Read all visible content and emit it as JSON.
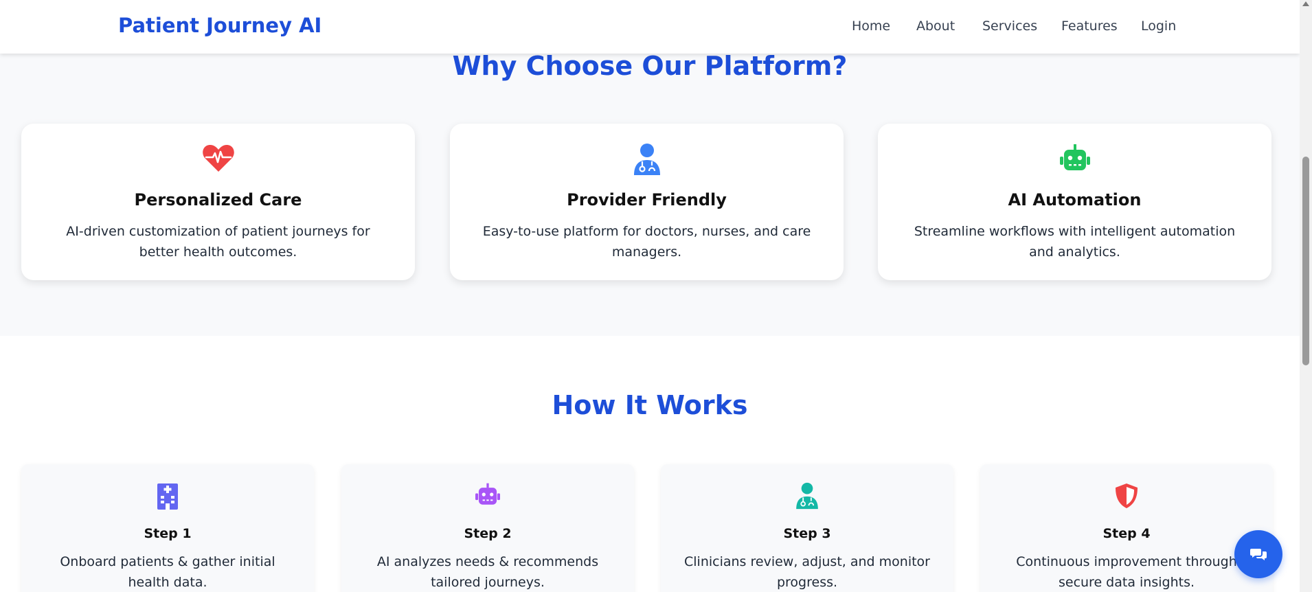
{
  "header": {
    "brand": "Patient Journey AI",
    "nav": [
      "Home",
      "About",
      "Services",
      "Features",
      "Login"
    ]
  },
  "why": {
    "title": "Why Choose Our Platform?",
    "cards": [
      {
        "icon": "heartbeat-icon",
        "title": "Personalized Care",
        "desc": "AI-driven customization of patient journeys for better health outcomes."
      },
      {
        "icon": "doctor-icon",
        "title": "Provider Friendly",
        "desc": "Easy-to-use platform for doctors, nurses, and care managers."
      },
      {
        "icon": "robot-icon",
        "title": "AI Automation",
        "desc": "Streamline workflows with intelligent automation and analytics."
      }
    ]
  },
  "how": {
    "title": "How It Works",
    "steps": [
      {
        "icon": "hospital-icon",
        "title": "Step 1",
        "desc": "Onboard patients & gather initial health data."
      },
      {
        "icon": "robot-icon",
        "title": "Step 2",
        "desc": "AI analyzes needs & recommends tailored journeys."
      },
      {
        "icon": "doctor-icon",
        "title": "Step 3",
        "desc": "Clinicians review, adjust, and monitor progress."
      },
      {
        "icon": "shield-icon",
        "title": "Step 4",
        "desc": "Continuous improvement through secure data insights."
      }
    ]
  },
  "chat": {
    "icon": "chat-icon"
  },
  "colors": {
    "brand": "#1d4ed8",
    "heart": "#ef4444",
    "doctor_blue": "#3b82f6",
    "robot_green": "#22c55e",
    "hospital_indigo": "#6366f1",
    "robot_purple": "#a855f7",
    "doctor_teal": "#14b8a6",
    "shield_red": "#ef4444",
    "chat_button": "#2563eb"
  }
}
